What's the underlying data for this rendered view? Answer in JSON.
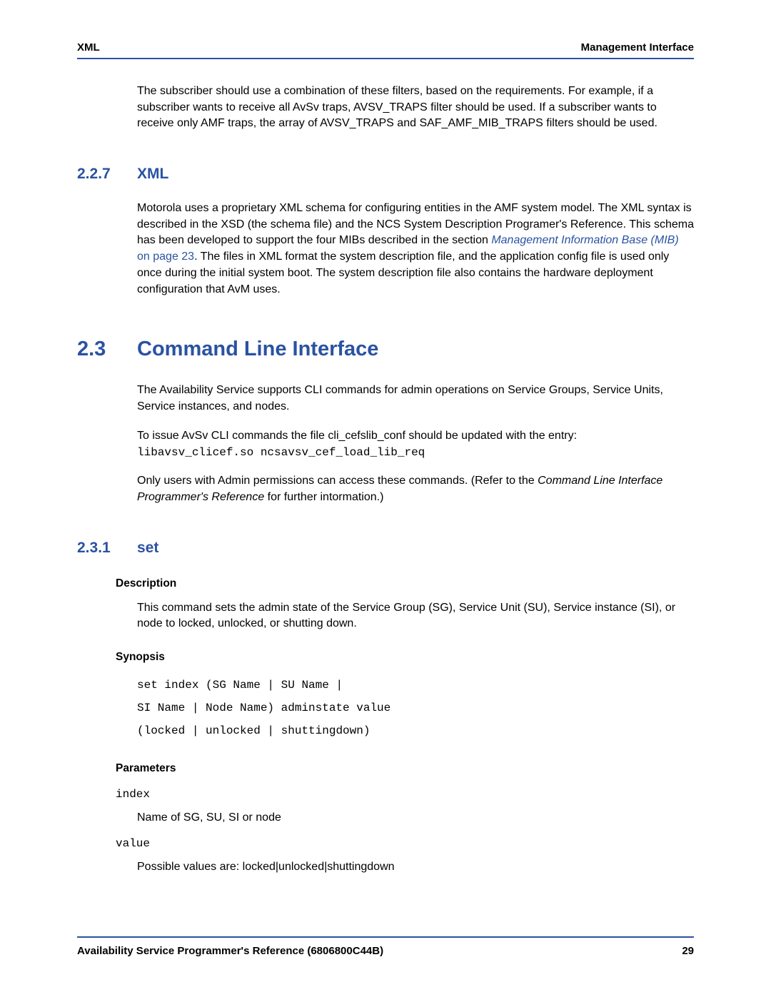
{
  "header": {
    "left": "XML",
    "right": "Management Interface"
  },
  "intro_para": "The subscriber should use a combination of these filters, based on the requirements. For example, if a subscriber wants to receive all AvSv traps, AVSV_TRAPS filter should be used. If a subscriber wants to receive only AMF traps, the array of AVSV_TRAPS and SAF_AMF_MIB_TRAPS filters should be used.",
  "sec227": {
    "num": "2.2.7",
    "title": "XML",
    "para_pre": "Motorola uses a proprietary XML schema for configuring entities in the AMF system model. The XML syntax is described in the XSD (the schema file) and the NCS System Description Programer's Reference. This schema has been developed to support the four MIBs described in the section ",
    "link_text": "Management Information Base (MIB)",
    "link_page": " on page 23",
    "para_post": ". The files in XML format the system description file, and the application config file is used only once during the initial system boot. The system description file also contains the hardware deployment configuration that AvM uses."
  },
  "sec23": {
    "num": "2.3",
    "title": "Command Line Interface",
    "p1": "The Availability Service supports CLI commands for admin operations on Service Groups, Service Units, Service instances, and nodes.",
    "p2_text": "To issue AvSv CLI commands the file cli_cefslib_conf should be updated with the entry:",
    "p2_code": "libavsv_clicef.so ncsavsv_cef_load_lib_req",
    "p3_pre": "Only users with Admin permissions can access these commands. (Refer to the ",
    "p3_ital": "Command Line Interface Programmer's Reference",
    "p3_post": " for further intormation.)"
  },
  "sec231": {
    "num": "2.3.1",
    "title": "set",
    "desc_head": "Description",
    "desc_body": "This command sets the admin state of the Service Group (SG), Service Unit (SU), Service instance (SI), or node to locked, unlocked, or shutting down.",
    "syn_head": "Synopsis",
    "syn_body": "set index (SG Name | SU Name |\nSI Name | Node Name) adminstate value\n(locked | unlocked | shuttingdown)",
    "param_head": "Parameters",
    "params": [
      {
        "name": "index",
        "desc": "Name of SG, SU, SI or node"
      },
      {
        "name": "value",
        "desc": "Possible values are: locked|unlocked|shuttingdown"
      }
    ]
  },
  "footer": {
    "left": "Availability Service Programmer's Reference (6806800C44B)",
    "right": "29"
  }
}
